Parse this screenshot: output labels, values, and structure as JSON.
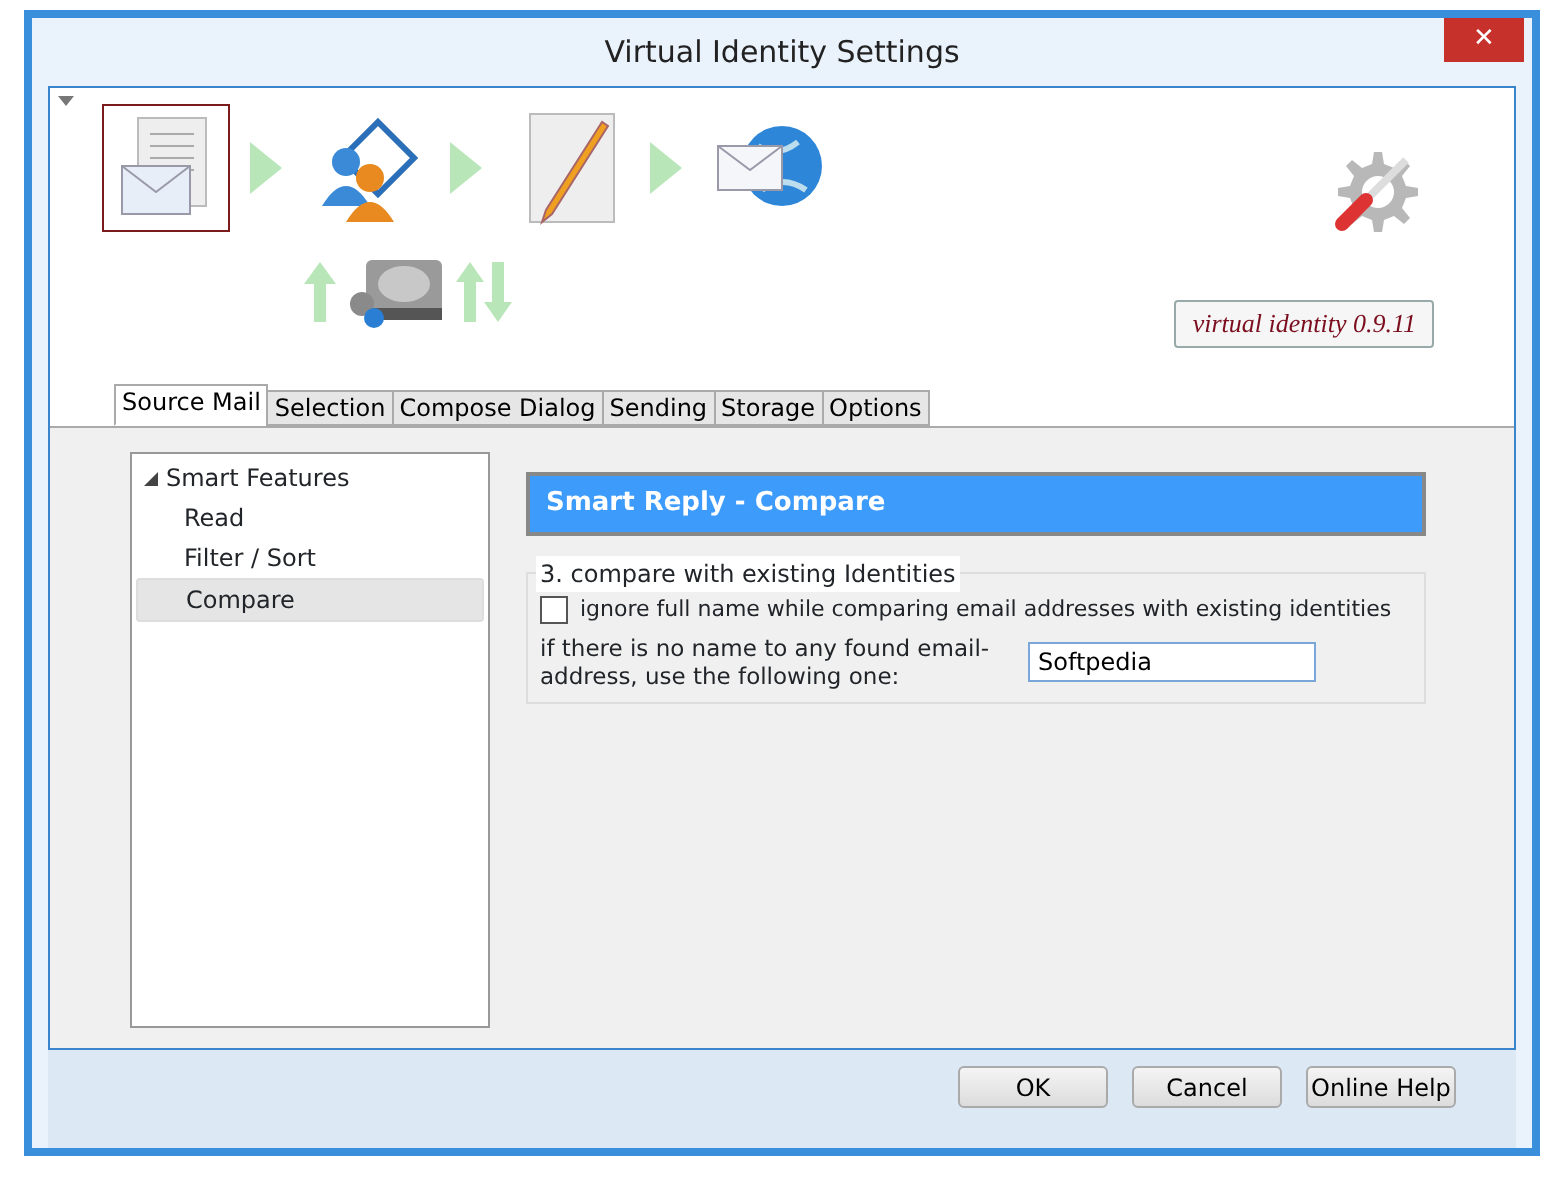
{
  "window": {
    "title": "Virtual Identity Settings",
    "close": "✕"
  },
  "flow_steps": [
    {
      "kind": "mail-document",
      "selected": true
    },
    {
      "kind": "users",
      "selected": false
    },
    {
      "kind": "pencil",
      "selected": false
    },
    {
      "kind": "mail-globe",
      "selected": false
    }
  ],
  "version": "virtual identity 0.9.11",
  "tabs": [
    {
      "label": "Source Mail",
      "selected": true
    },
    {
      "label": "Selection",
      "selected": false
    },
    {
      "label": "Compose Dialog",
      "selected": false
    },
    {
      "label": "Sending",
      "selected": false
    },
    {
      "label": "Storage",
      "selected": false
    },
    {
      "label": "Options",
      "selected": false
    }
  ],
  "tree": [
    {
      "label": "Smart Features",
      "expanded": true,
      "selected": false,
      "children": [
        {
          "label": "Read",
          "selected": false
        },
        {
          "label": "Filter / Sort",
          "selected": false
        },
        {
          "label": "Compare",
          "selected": true
        }
      ]
    }
  ],
  "panel": {
    "header": "Smart Reply - Compare",
    "group": "3. compare with existing Identities",
    "checkbox": {
      "label": "ignore full name while comparing email addresses with existing identities",
      "checked": false
    },
    "field": {
      "label": "if there is no name to any found email-address, use the following one:",
      "value": "Softpedia"
    }
  },
  "buttons": [
    "OK",
    "Cancel",
    "Online Help"
  ]
}
